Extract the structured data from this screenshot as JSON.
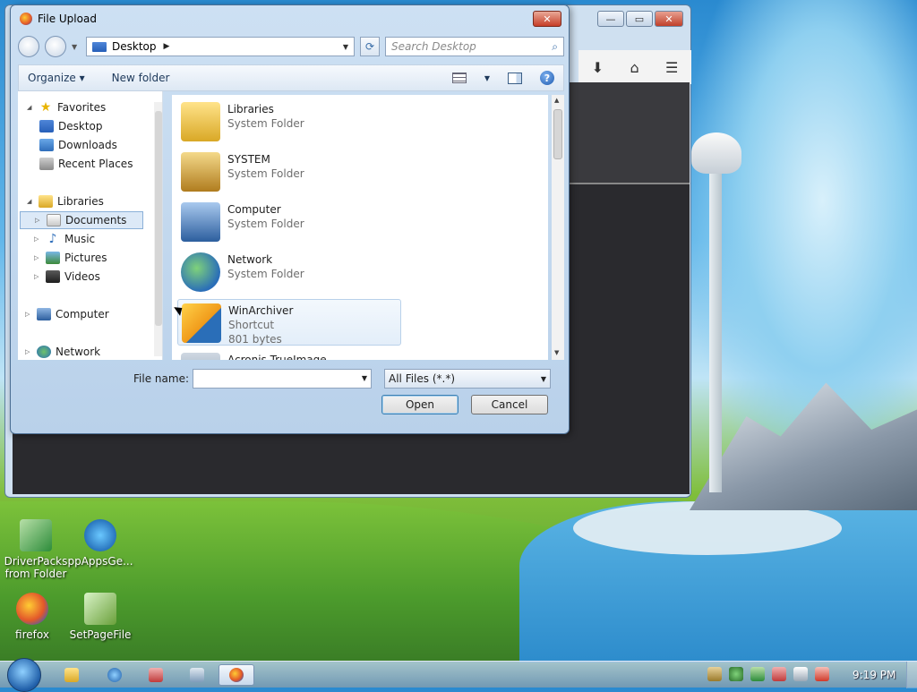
{
  "dialog": {
    "title": "File Upload",
    "address": "Desktop",
    "search_placeholder": "Search Desktop",
    "organize_label": "Organize",
    "new_folder_label": "New folder",
    "nav": {
      "favorites": "Favorites",
      "desktop": "Desktop",
      "downloads": "Downloads",
      "recent_places": "Recent Places",
      "libraries": "Libraries",
      "documents": "Documents",
      "music": "Music",
      "pictures": "Pictures",
      "videos": "Videos",
      "computer": "Computer",
      "network": "Network"
    },
    "files": [
      {
        "name": "Libraries",
        "sub": "System Folder"
      },
      {
        "name": "SYSTEM",
        "sub": "System Folder"
      },
      {
        "name": "Computer",
        "sub": "System Folder"
      },
      {
        "name": "Network",
        "sub": "System Folder"
      },
      {
        "name": "WinArchiver",
        "sub": "Shortcut",
        "size": "801 bytes"
      },
      {
        "name": "Acronis TrueImage",
        "sub": ""
      }
    ],
    "file_name_label": "File name:",
    "file_name_value": "",
    "file_type": "All Files (*.*)",
    "open_label": "Open",
    "cancel_label": "Cancel"
  },
  "desktop_icons": {
    "driverpacks": "DriverPacks from Folder",
    "ppapps": "ppAppsGe...",
    "firefox": "firefox",
    "setpagefile": "SetPageFile"
  },
  "taskbar": {
    "clock": "9:19 PM"
  },
  "colors": {
    "accent": "#3c7fb1",
    "dialog_bg": "#cde0f3",
    "close_red": "#c63d27"
  }
}
